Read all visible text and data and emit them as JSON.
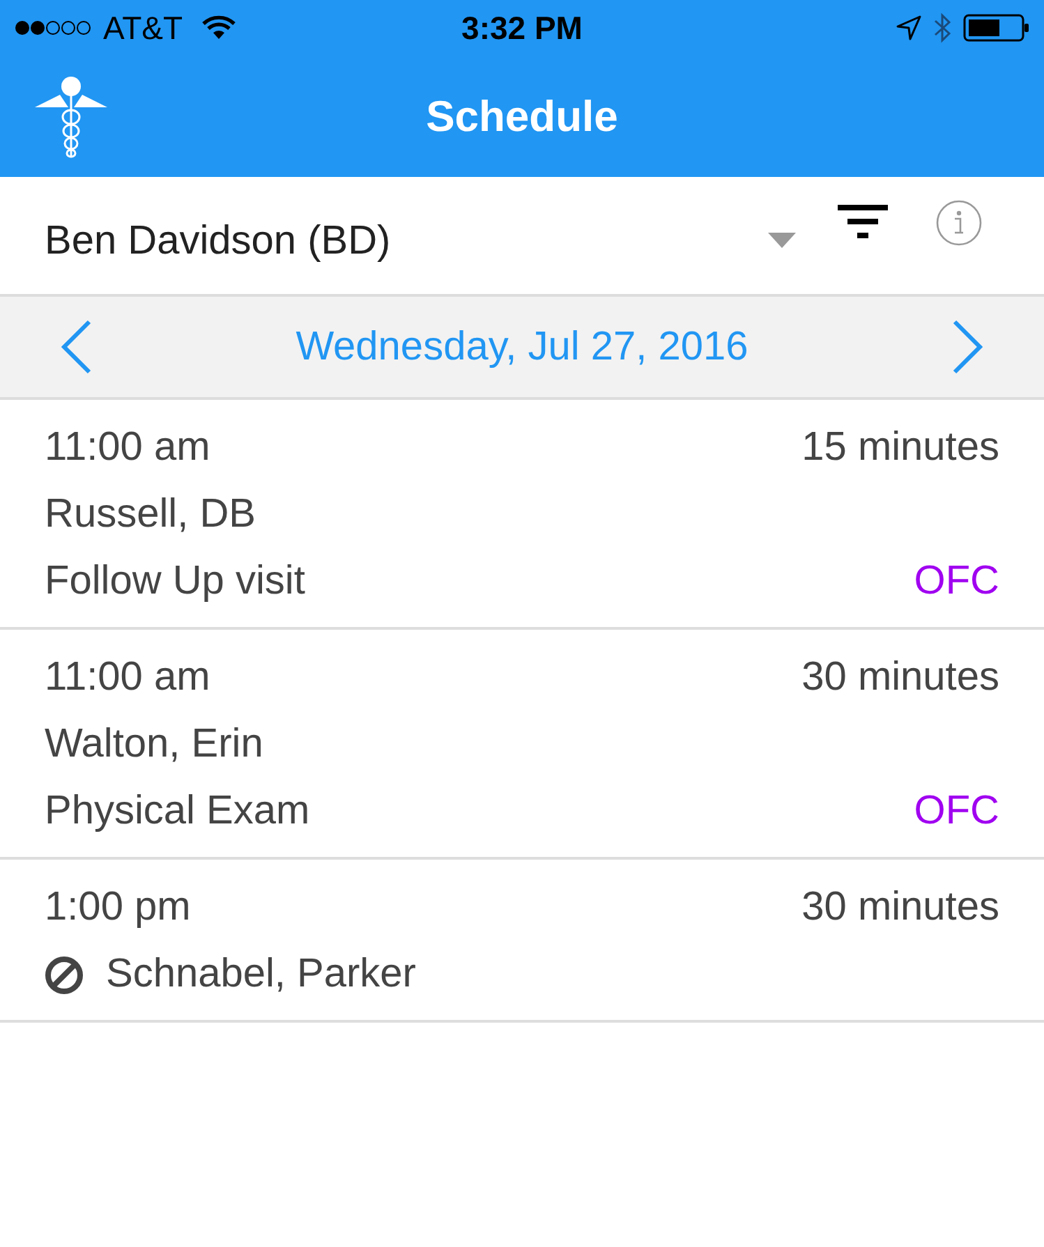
{
  "status_bar": {
    "carrier": "AT&T",
    "time": "3:32 PM"
  },
  "header": {
    "title": "Schedule"
  },
  "provider": {
    "name": "Ben Davidson (BD)"
  },
  "date_bar": {
    "date": "Wednesday, Jul 27, 2016"
  },
  "appointments": [
    {
      "time": "11:00 am",
      "duration": "15 minutes",
      "patient": "Russell, DB",
      "visit_type": "Follow Up visit",
      "location": "OFC",
      "blocked": false
    },
    {
      "time": "11:00 am",
      "duration": "30 minutes",
      "patient": "Walton, Erin",
      "visit_type": "Physical Exam",
      "location": "OFC",
      "blocked": false
    },
    {
      "time": "1:00 pm",
      "duration": "30 minutes",
      "patient": "Schnabel, Parker",
      "blocked": true
    }
  ]
}
